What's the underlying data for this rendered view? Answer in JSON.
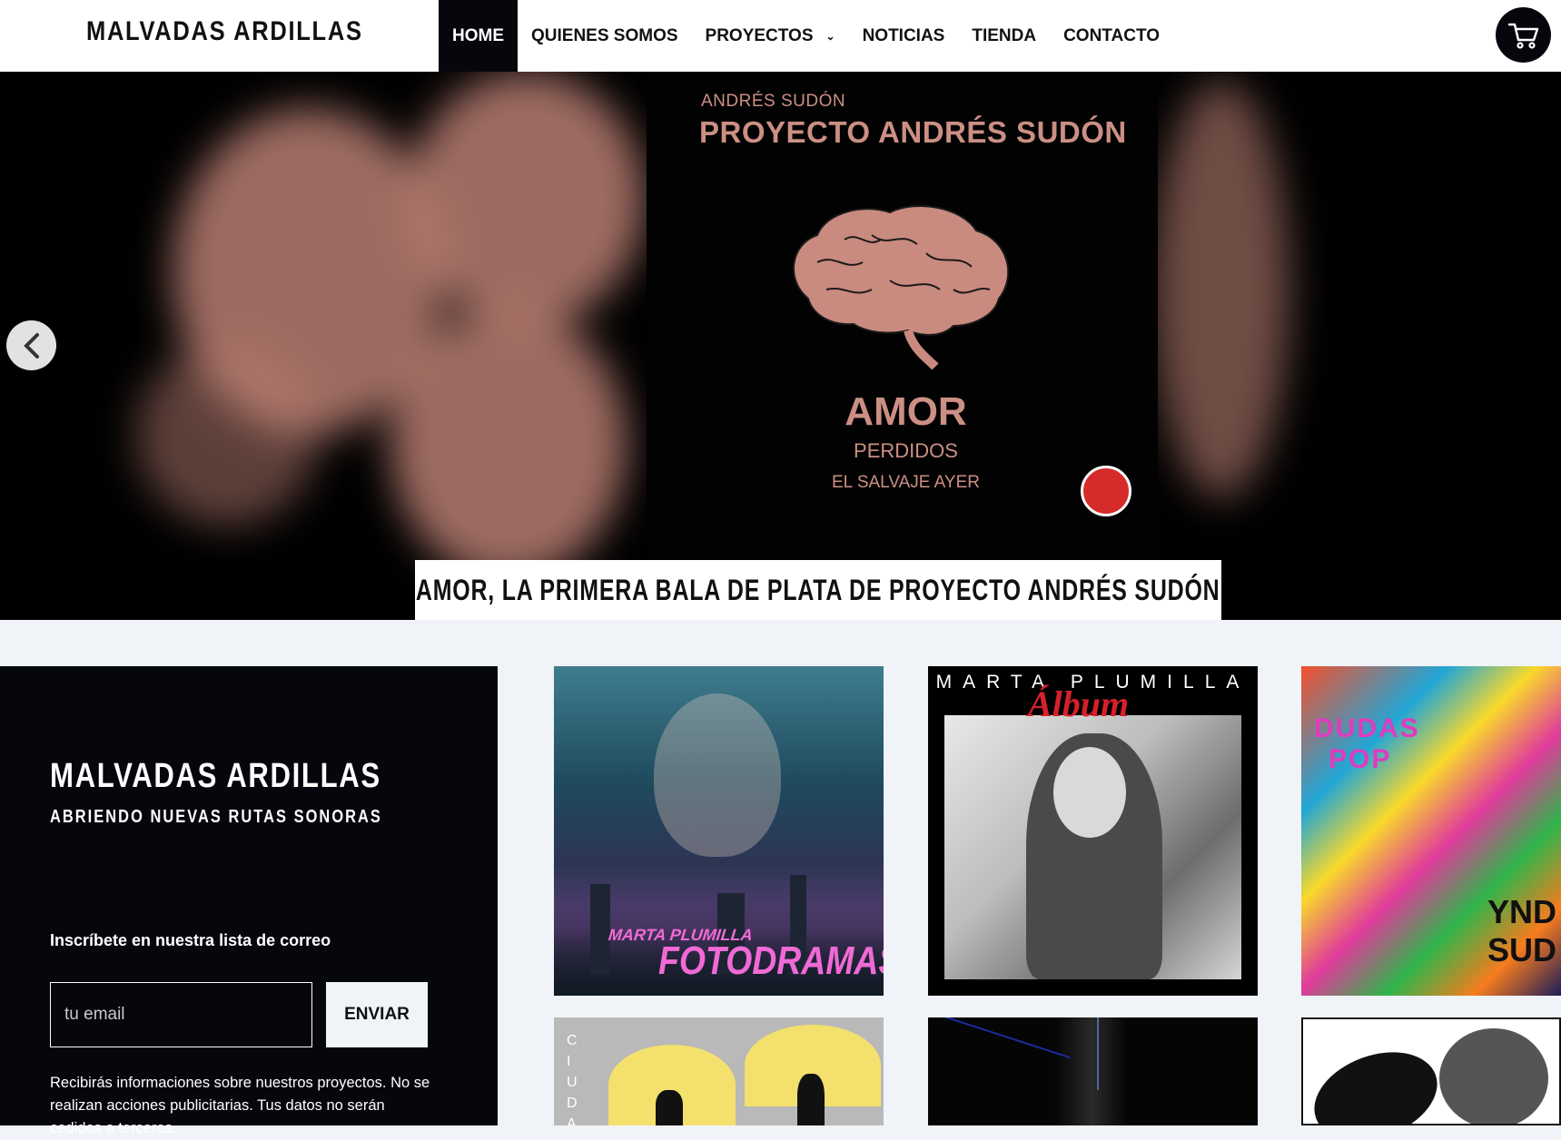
{
  "header": {
    "logo": "MALVADAS ARDILLAS",
    "nav": [
      "HOME",
      "QUIENES SOMOS",
      "PROYECTOS",
      "NOTICIAS",
      "TIENDA",
      "CONTACTO"
    ],
    "cart_icon": "cart-icon"
  },
  "hero": {
    "cover": {
      "artist": "ANDRÉS SUDÓN",
      "project": "PROYECTO ANDRÉS SUDÓN",
      "title": "AMOR",
      "line2": "PERDIDOS",
      "line3": "EL SALVAJE AYER"
    },
    "caption": "AMOR, LA PRIMERA BALA DE PLATA DE PROYECTO ANDRÉS SUDÓN",
    "prev_icon": "chevron-left-icon"
  },
  "sidebar": {
    "title": "MALVADAS ARDILLAS",
    "subtitle": "ABRIENDO NUEVAS RUTAS SONORAS",
    "newsletter_heading": "Inscríbete en nuestra lista de correo",
    "email_placeholder": "tu email",
    "send_label": "ENVIAR",
    "note": "Recibirás informaciones sobre nuestros proyectos. No se realizan acciones publicitarias. Tus datos no serán cedidos a terceros."
  },
  "grid": {
    "tile1": {
      "artist": "MARTA PLUMILLA",
      "title": "FOTODRAMAS"
    },
    "tile2": {
      "artist": "MARTA PLUMILLA",
      "title": "Álbum"
    },
    "tile3": {
      "text1": "DUDAS",
      "text2": "POP",
      "text3": "YND",
      "text4": "SUD"
    },
    "tile4": {
      "side": "CIUDA"
    }
  },
  "colors": {
    "nav_active_bg": "#05070d",
    "cover_text": "#cc8f84",
    "page_bg": "#f0f4f8"
  }
}
